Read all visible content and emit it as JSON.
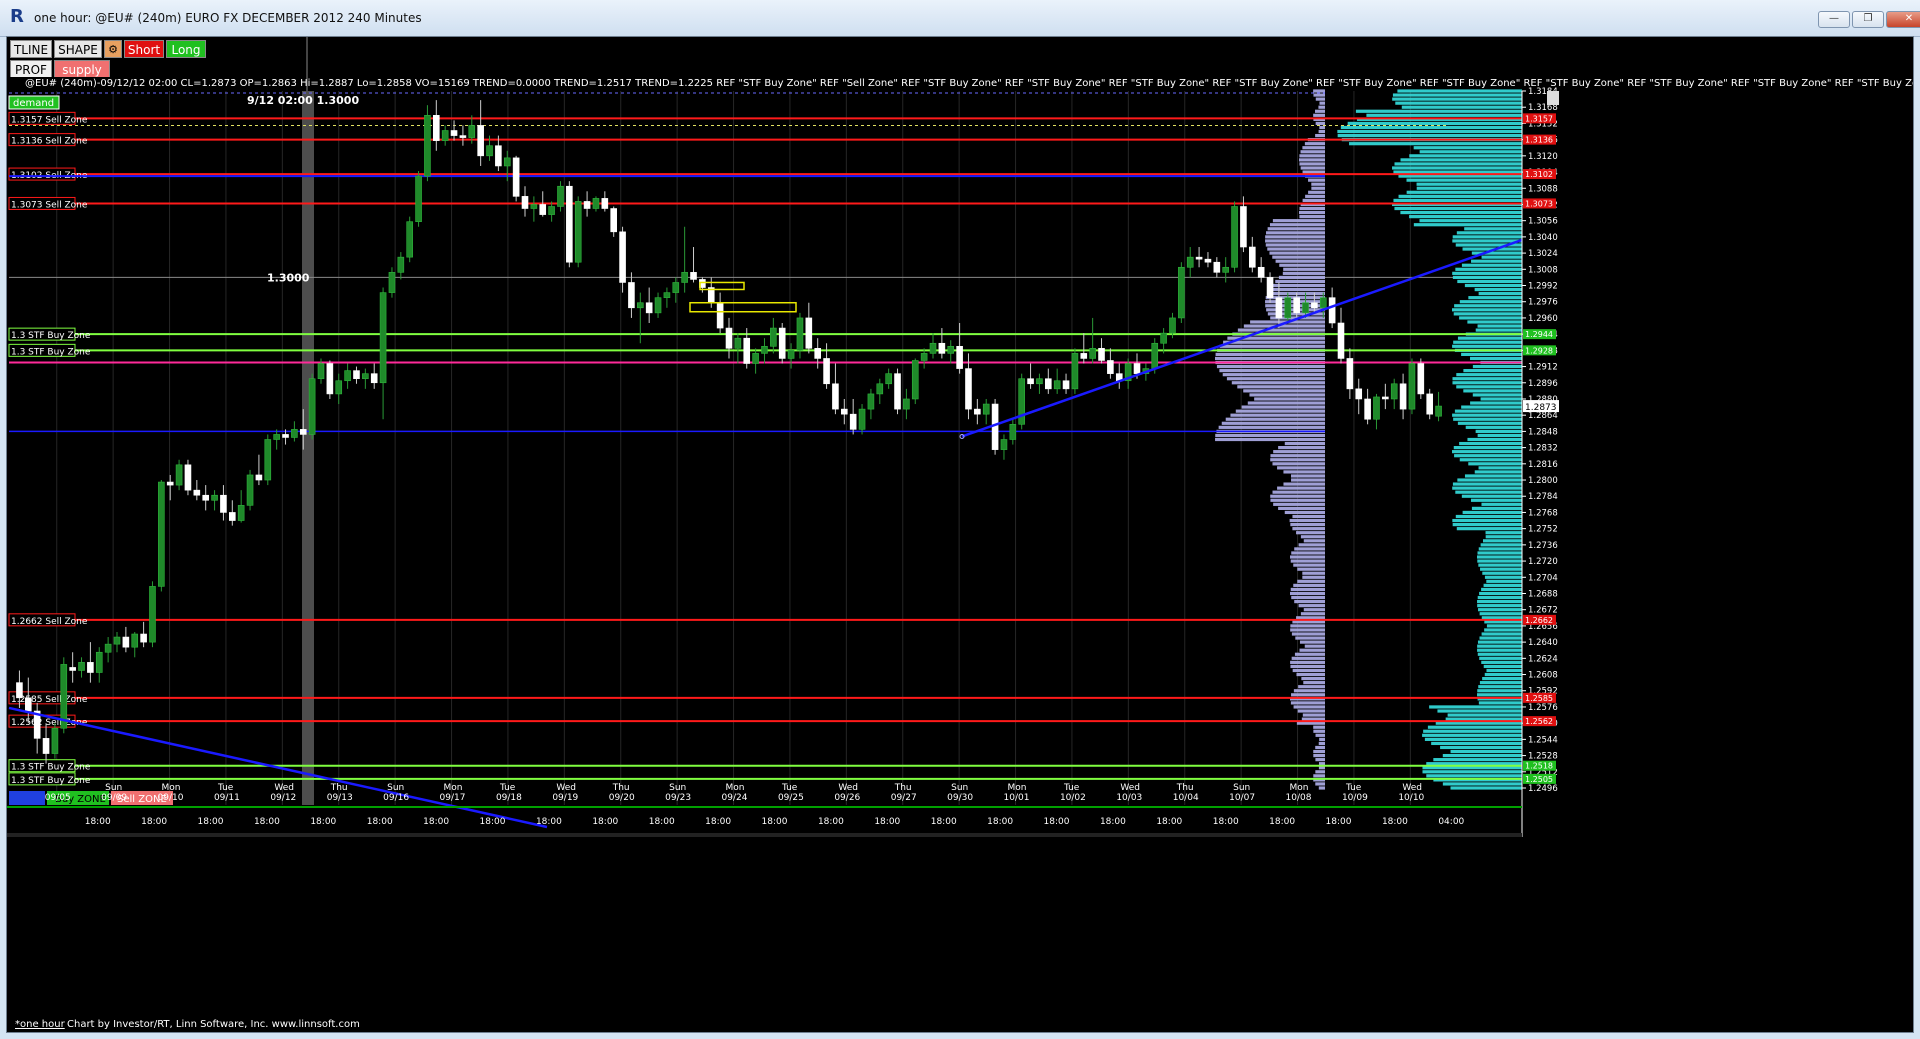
{
  "window": {
    "title": "one hour: @EU# (240m) EURO FX DECEMBER 2012 240 Minutes",
    "minimize_label": "—",
    "restore_label": "❐",
    "close_label": "✕"
  },
  "toolbar": {
    "tline_label": "TLINE",
    "shape_label": "SHAPE",
    "short_label": "Short",
    "long_label": "Long",
    "prof_label": "PROF",
    "supply_label": "supply",
    "demand_label": "demand"
  },
  "infobar": {
    "text": "@EU# (240m)-09/12/12 02:00 CL=1.2873 OP=1.2863 Hi=1.2887 Lo=1.2858 VO=15169  TREND=0.0000  TREND=1.2517  TREND=1.2225  REF \"STF Buy Zone\"  REF \"Sell Zone\"  REF \"STF Buy Zone\"  REF \"STF Buy Zone\"  REF \"STF Buy Zone\"  REF \"STF Buy Zone\"  REF \"STF Buy Zone\"  REF \"STF Buy Zone\"  REF \"STF Buy Zone\"  REF \"STF Buy Zone\"  REF \"STF Buy Zone\"  REF \"STF Buy Zone\""
  },
  "annotations": {
    "cursor_label": "9/12 02:00 1.3000",
    "level_1300": "1.3000"
  },
  "colors": {
    "background": "#000000",
    "up_candle": "#1f8a2a",
    "down_candle": "#ffffff",
    "sell_zone": "#ff1a1a",
    "buy_zone": "#80ff40",
    "trendline": "#1a1aff",
    "magenta_line": "#ff2a9a",
    "volume_profile": "#a8a8e0",
    "right_profile": "#33d6d6",
    "grid": "#262626"
  },
  "zones": [
    {
      "price": 1.3157,
      "label": "1.3157 Sell Zone",
      "type": "sell"
    },
    {
      "price": 1.3136,
      "label": "1.3136 Sell Zone",
      "type": "sell"
    },
    {
      "price": 1.3102,
      "label": "1.3102 Sell Zone",
      "type": "sell"
    },
    {
      "price": 1.3073,
      "label": "1.3073 Sell Zone",
      "type": "sell"
    },
    {
      "price": 1.2944,
      "label": "1.3 STF Buy Zone",
      "type": "buy"
    },
    {
      "price": 1.2928,
      "label": "1.3 STF Buy Zone",
      "type": "buy"
    },
    {
      "price": 1.2662,
      "label": "1.2662 Sell Zone",
      "type": "sell"
    },
    {
      "price": 1.2585,
      "label": "1.2585 Sell Zone",
      "type": "sell"
    },
    {
      "price": 1.2562,
      "label": "1.2562 Sell Zone",
      "type": "sell"
    },
    {
      "price": 1.2518,
      "label": "1.3 STF Buy Zone",
      "type": "buy"
    },
    {
      "price": 1.2505,
      "label": "1.3 STF Buy Zone",
      "type": "buy"
    }
  ],
  "legend_buttons": {
    "blank_label": "",
    "buy_label": "Buy ZONE",
    "sell_label": "Sell ZONE"
  },
  "price_axis": {
    "ticks": [
      "1.3184",
      "1.3168",
      "1.3152",
      "1.3136",
      "1.3120",
      "1.3104",
      "1.3088",
      "1.3072",
      "1.3056",
      "1.3040",
      "1.3024",
      "1.3008",
      "1.2992",
      "1.2976",
      "1.2960",
      "1.2944",
      "1.2928",
      "1.2912",
      "1.2896",
      "1.2880",
      "1.2864",
      "1.2848",
      "1.2832",
      "1.2816",
      "1.2800",
      "1.2784",
      "1.2768",
      "1.2752",
      "1.2736",
      "1.2720",
      "1.2704",
      "1.2688",
      "1.2672",
      "1.2656",
      "1.2640",
      "1.2624",
      "1.2608",
      "1.2592",
      "1.2576",
      "1.2560",
      "1.2544",
      "1.2528",
      "1.2512",
      "1.2496"
    ],
    "current_price": "1.2873",
    "tags": [
      "1.3157",
      "1.3136",
      "1.3102",
      "1.3073",
      "1.2944",
      "1.2928",
      "1.2662",
      "1.2585",
      "1.2562",
      "1.2518",
      "1.2505"
    ]
  },
  "time_axis": {
    "day_labels": [
      {
        "day": "",
        "date": "09/05"
      },
      {
        "day": "Sun",
        "date": "09/09"
      },
      {
        "day": "Mon",
        "date": "09/10"
      },
      {
        "day": "Tue",
        "date": "09/11"
      },
      {
        "day": "Wed",
        "date": "09/12"
      },
      {
        "day": "Thu",
        "date": "09/13"
      },
      {
        "day": "Sun",
        "date": "09/16"
      },
      {
        "day": "Mon",
        "date": "09/17"
      },
      {
        "day": "Tue",
        "date": "09/18"
      },
      {
        "day": "Wed",
        "date": "09/19"
      },
      {
        "day": "Thu",
        "date": "09/20"
      },
      {
        "day": "Sun",
        "date": "09/23"
      },
      {
        "day": "Mon",
        "date": "09/24"
      },
      {
        "day": "Tue",
        "date": "09/25"
      },
      {
        "day": "Wed",
        "date": "09/26"
      },
      {
        "day": "Thu",
        "date": "09/27"
      },
      {
        "day": "Sun",
        "date": "09/30"
      },
      {
        "day": "Mon",
        "date": "10/01"
      },
      {
        "day": "Tue",
        "date": "10/02"
      },
      {
        "day": "Wed",
        "date": "10/03"
      },
      {
        "day": "Thu",
        "date": "10/04"
      },
      {
        "day": "Sun",
        "date": "10/07"
      },
      {
        "day": "Mon",
        "date": "10/08"
      },
      {
        "day": "Tue",
        "date": "10/09"
      },
      {
        "day": "Wed",
        "date": "10/10"
      }
    ],
    "hour_label": "18:00",
    "last_hour_label": "04:00"
  },
  "status": {
    "tab_label": "*one hour",
    "credit": "Chart by Investor/RT, Linn Software, Inc. www.linnsoft.com"
  },
  "chart_data": {
    "type": "candlestick",
    "symbol": "@EU# (240m)",
    "ylim": [
      1.2488,
      1.3196
    ],
    "candles": [
      [
        1.26,
        1.2612,
        1.2575,
        1.2585
      ],
      [
        1.2585,
        1.2605,
        1.256,
        1.2572
      ],
      [
        1.2572,
        1.258,
        1.253,
        1.2545
      ],
      [
        1.2545,
        1.256,
        1.252,
        1.253
      ],
      [
        1.253,
        1.256,
        1.2525,
        1.2555
      ],
      [
        1.2555,
        1.2625,
        1.255,
        1.2618
      ],
      [
        1.2615,
        1.263,
        1.26,
        1.2612
      ],
      [
        1.2612,
        1.2625,
        1.2605,
        1.262
      ],
      [
        1.262,
        1.264,
        1.26,
        1.261
      ],
      [
        1.261,
        1.2635,
        1.26,
        1.263
      ],
      [
        1.263,
        1.2645,
        1.262,
        1.2638
      ],
      [
        1.2638,
        1.265,
        1.263,
        1.2645
      ],
      [
        1.2645,
        1.2655,
        1.263,
        1.2635
      ],
      [
        1.2635,
        1.265,
        1.2625,
        1.2648
      ],
      [
        1.2648,
        1.266,
        1.2635,
        1.264
      ],
      [
        1.264,
        1.27,
        1.2635,
        1.2695
      ],
      [
        1.2695,
        1.28,
        1.269,
        1.2798
      ],
      [
        1.2798,
        1.2805,
        1.278,
        1.2795
      ],
      [
        1.2795,
        1.282,
        1.279,
        1.2815
      ],
      [
        1.2815,
        1.282,
        1.2785,
        1.279
      ],
      [
        1.279,
        1.28,
        1.278,
        1.2785
      ],
      [
        1.2785,
        1.2795,
        1.277,
        1.278
      ],
      [
        1.278,
        1.279,
        1.277,
        1.2785
      ],
      [
        1.2785,
        1.2795,
        1.276,
        1.2768
      ],
      [
        1.2768,
        1.278,
        1.2755,
        1.276
      ],
      [
        1.276,
        1.279,
        1.2758,
        1.2775
      ],
      [
        1.2775,
        1.281,
        1.277,
        1.2805
      ],
      [
        1.2805,
        1.2825,
        1.2795,
        1.28
      ],
      [
        1.28,
        1.2845,
        1.2795,
        1.284
      ],
      [
        1.284,
        1.285,
        1.283,
        1.2845
      ],
      [
        1.2845,
        1.285,
        1.2835,
        1.2842
      ],
      [
        1.2842,
        1.2858,
        1.2838,
        1.285
      ],
      [
        1.285,
        1.287,
        1.283,
        1.2845
      ],
      [
        1.2845,
        1.2905,
        1.284,
        1.29
      ],
      [
        1.29,
        1.292,
        1.2895,
        1.2915
      ],
      [
        1.2915,
        1.2918,
        1.288,
        1.2885
      ],
      [
        1.2885,
        1.2905,
        1.2875,
        1.2898
      ],
      [
        1.2898,
        1.2915,
        1.289,
        1.2908
      ],
      [
        1.2908,
        1.2912,
        1.2895,
        1.29
      ],
      [
        1.29,
        1.291,
        1.289,
        1.2905
      ],
      [
        1.2905,
        1.2915,
        1.289,
        1.2896
      ],
      [
        1.2896,
        1.299,
        1.286,
        1.2985
      ],
      [
        1.2985,
        1.301,
        1.298,
        1.3005
      ],
      [
        1.3005,
        1.3025,
        1.2998,
        1.302
      ],
      [
        1.302,
        1.306,
        1.3015,
        1.3055
      ],
      [
        1.3055,
        1.3105,
        1.305,
        1.31
      ],
      [
        1.31,
        1.317,
        1.3095,
        1.316
      ],
      [
        1.316,
        1.3175,
        1.3125,
        1.3135
      ],
      [
        1.3135,
        1.315,
        1.313,
        1.3145
      ],
      [
        1.3145,
        1.3155,
        1.3135,
        1.314
      ],
      [
        1.314,
        1.315,
        1.313,
        1.3138
      ],
      [
        1.3138,
        1.316,
        1.3132,
        1.315
      ],
      [
        1.315,
        1.3175,
        1.311,
        1.312
      ],
      [
        1.312,
        1.314,
        1.3115,
        1.313
      ],
      [
        1.313,
        1.314,
        1.3105,
        1.311
      ],
      [
        1.311,
        1.3125,
        1.3095,
        1.3118
      ],
      [
        1.3118,
        1.312,
        1.3075,
        1.308
      ],
      [
        1.308,
        1.309,
        1.306,
        1.3068
      ],
      [
        1.3068,
        1.308,
        1.3055,
        1.3072
      ],
      [
        1.3072,
        1.3085,
        1.306,
        1.3062
      ],
      [
        1.3062,
        1.3075,
        1.3055,
        1.307
      ],
      [
        1.307,
        1.3095,
        1.3065,
        1.309
      ],
      [
        1.309,
        1.3095,
        1.301,
        1.3015
      ],
      [
        1.3015,
        1.308,
        1.301,
        1.3075
      ],
      [
        1.3075,
        1.3085,
        1.306,
        1.3068
      ],
      [
        1.3068,
        1.308,
        1.3065,
        1.3078
      ],
      [
        1.3078,
        1.3085,
        1.3065,
        1.3068
      ],
      [
        1.3068,
        1.307,
        1.304,
        1.3045
      ],
      [
        1.3045,
        1.305,
        1.2985,
        1.2995
      ],
      [
        1.2995,
        1.3005,
        1.296,
        1.297
      ],
      [
        1.297,
        1.2985,
        1.2935,
        1.2975
      ],
      [
        1.2975,
        1.299,
        1.2955,
        1.2965
      ],
      [
        1.2965,
        1.2985,
        1.296,
        1.298
      ],
      [
        1.298,
        1.299,
        1.297,
        1.2985
      ],
      [
        1.2985,
        1.3,
        1.2975,
        1.2995
      ],
      [
        1.2995,
        1.305,
        1.2985,
        1.3005
      ],
      [
        1.3005,
        1.303,
        1.2995,
        1.2998
      ],
      [
        1.2998,
        1.3,
        1.2985,
        1.299
      ],
      [
        1.299,
        1.3,
        1.297,
        1.2975
      ],
      [
        1.2975,
        1.2985,
        1.2945,
        1.295
      ],
      [
        1.295,
        1.296,
        1.292,
        1.293
      ],
      [
        1.293,
        1.2945,
        1.2915,
        1.294
      ],
      [
        1.294,
        1.295,
        1.291,
        1.2915
      ],
      [
        1.2915,
        1.293,
        1.2905,
        1.2925
      ],
      [
        1.2925,
        1.294,
        1.2915,
        1.2932
      ],
      [
        1.2932,
        1.296,
        1.2925,
        1.295
      ],
      [
        1.295,
        1.2955,
        1.2915,
        1.292
      ],
      [
        1.292,
        1.2935,
        1.291,
        1.2928
      ],
      [
        1.2928,
        1.2965,
        1.292,
        1.296
      ],
      [
        1.296,
        1.2975,
        1.2925,
        1.293
      ],
      [
        1.293,
        1.294,
        1.291,
        1.292
      ],
      [
        1.292,
        1.2935,
        1.289,
        1.2895
      ],
      [
        1.2895,
        1.2915,
        1.2865,
        1.287
      ],
      [
        1.287,
        1.288,
        1.2855,
        1.2865
      ],
      [
        1.2865,
        1.288,
        1.2845,
        1.285
      ],
      [
        1.285,
        1.2875,
        1.2845,
        1.287
      ],
      [
        1.287,
        1.289,
        1.286,
        1.2885
      ],
      [
        1.2885,
        1.29,
        1.2875,
        1.2895
      ],
      [
        1.2895,
        1.291,
        1.289,
        1.2905
      ],
      [
        1.2905,
        1.291,
        1.2865,
        1.287
      ],
      [
        1.287,
        1.289,
        1.286,
        1.288
      ],
      [
        1.288,
        1.292,
        1.2875,
        1.2918
      ],
      [
        1.2918,
        1.293,
        1.291,
        1.2925
      ],
      [
        1.2925,
        1.2945,
        1.292,
        1.2935
      ],
      [
        1.2935,
        1.295,
        1.292,
        1.2925
      ],
      [
        1.2925,
        1.2938,
        1.2915,
        1.2932
      ],
      [
        1.2932,
        1.2955,
        1.2905,
        1.291
      ],
      [
        1.291,
        1.2925,
        1.286,
        1.287
      ],
      [
        1.287,
        1.288,
        1.2855,
        1.2865
      ],
      [
        1.2865,
        1.288,
        1.2855,
        1.2875
      ],
      [
        1.2875,
        1.288,
        1.2825,
        1.283
      ],
      [
        1.283,
        1.2845,
        1.282,
        1.284
      ],
      [
        1.284,
        1.286,
        1.2835,
        1.2855
      ],
      [
        1.2855,
        1.2905,
        1.285,
        1.29
      ],
      [
        1.29,
        1.2915,
        1.289,
        1.2895
      ],
      [
        1.2895,
        1.2905,
        1.2885,
        1.29
      ],
      [
        1.29,
        1.291,
        1.2885,
        1.289
      ],
      [
        1.289,
        1.291,
        1.2885,
        1.2898
      ],
      [
        1.2898,
        1.2905,
        1.2885,
        1.289
      ],
      [
        1.289,
        1.293,
        1.2885,
        1.2925
      ],
      [
        1.2925,
        1.2945,
        1.2915,
        1.292
      ],
      [
        1.292,
        1.296,
        1.2915,
        1.293
      ],
      [
        1.293,
        1.294,
        1.2915,
        1.2918
      ],
      [
        1.2918,
        1.293,
        1.29,
        1.2905
      ],
      [
        1.2905,
        1.2915,
        1.289,
        1.2898
      ],
      [
        1.2898,
        1.292,
        1.289,
        1.2915
      ],
      [
        1.2915,
        1.2925,
        1.29,
        1.2905
      ],
      [
        1.2905,
        1.2915,
        1.2898,
        1.291
      ],
      [
        1.291,
        1.294,
        1.2905,
        1.2935
      ],
      [
        1.2935,
        1.295,
        1.2925,
        1.2945
      ],
      [
        1.2945,
        1.2965,
        1.294,
        1.296
      ],
      [
        1.296,
        1.3015,
        1.2955,
        1.301
      ],
      [
        1.301,
        1.303,
        1.3,
        1.302
      ],
      [
        1.302,
        1.303,
        1.301,
        1.3018
      ],
      [
        1.3018,
        1.3025,
        1.301,
        1.3015
      ],
      [
        1.3015,
        1.302,
        1.3,
        1.3005
      ],
      [
        1.3005,
        1.302,
        1.2995,
        1.301
      ],
      [
        1.301,
        1.3075,
        1.3005,
        1.307
      ],
      [
        1.307,
        1.308,
        1.3025,
        1.303
      ],
      [
        1.303,
        1.304,
        1.3005,
        1.301
      ],
      [
        1.301,
        1.302,
        1.2995,
        1.3
      ],
      [
        1.3,
        1.3005,
        1.2975,
        1.298
      ],
      [
        1.298,
        1.2995,
        1.295,
        1.296
      ],
      [
        1.296,
        1.2985,
        1.2955,
        1.298
      ],
      [
        1.298,
        1.2985,
        1.296,
        1.2965
      ],
      [
        1.2965,
        1.2985,
        1.296,
        1.2975
      ],
      [
        1.2975,
        1.2985,
        1.2965,
        1.297
      ],
      [
        1.297,
        1.2985,
        1.296,
        1.298
      ],
      [
        1.298,
        1.299,
        1.295,
        1.2955
      ],
      [
        1.2955,
        1.297,
        1.2915,
        1.292
      ],
      [
        1.292,
        1.293,
        1.288,
        1.289
      ],
      [
        1.289,
        1.29,
        1.2865,
        1.288
      ],
      [
        1.288,
        1.289,
        1.2855,
        1.286
      ],
      [
        1.286,
        1.2885,
        1.285,
        1.2882
      ],
      [
        1.2882,
        1.2895,
        1.287,
        1.288
      ],
      [
        1.288,
        1.29,
        1.287,
        1.2895
      ],
      [
        1.2895,
        1.2905,
        1.286,
        1.287
      ],
      [
        1.287,
        1.292,
        1.2865,
        1.2915
      ],
      [
        1.2915,
        1.292,
        1.288,
        1.2885
      ],
      [
        1.2885,
        1.289,
        1.286,
        1.2865
      ],
      [
        1.2863,
        1.2887,
        1.2858,
        1.2873
      ]
    ],
    "series": [
      {
        "name": "TREND",
        "values": [
          0.0
        ]
      },
      {
        "name": "TREND",
        "values": [
          1.2517
        ]
      },
      {
        "name": "TREND",
        "values": [
          1.2225
        ]
      }
    ],
    "last": {
      "open": 1.2863,
      "high": 1.2887,
      "low": 1.2858,
      "close": 1.2873,
      "volume": 15169
    }
  }
}
